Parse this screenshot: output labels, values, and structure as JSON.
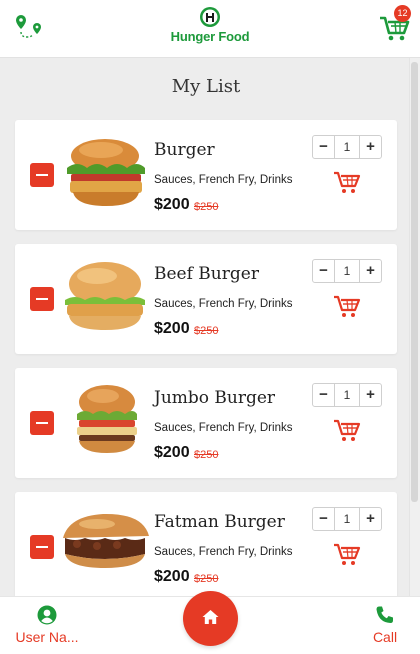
{
  "header": {
    "route_icon": "location-route-icon",
    "logo_icon": "chef-hat-icon",
    "logo_text": "Hunger Food",
    "cart_icon": "shopping-cart-icon",
    "cart_count": "12"
  },
  "page_title": "My List",
  "items": [
    {
      "name": "Burger",
      "description": "Sauces, French Fry, Drinks",
      "price": "$200",
      "old_price": "$250",
      "quantity": "1",
      "image": "burger"
    },
    {
      "name": "Beef Burger",
      "description": "Sauces, French Fry, Drinks",
      "price": "$200",
      "old_price": "$250",
      "quantity": "1",
      "image": "beef-burger"
    },
    {
      "name": "Jumbo Burger",
      "description": "Sauces, French Fry, Drinks",
      "price": "$200",
      "old_price": "$250",
      "quantity": "1",
      "image": "jumbo-burger"
    },
    {
      "name": "Fatman Burger",
      "description": "Sauces, French Fry, Drinks",
      "price": "$200",
      "old_price": "$250",
      "quantity": "1",
      "image": "fatman-burger"
    }
  ],
  "stepper": {
    "minus": "−",
    "plus": "+"
  },
  "bottom_nav": {
    "user_label": "User Na...",
    "user_icon": "user-circle-icon",
    "home_icon": "home-icon",
    "call_label": "Call",
    "call_icon": "phone-icon"
  },
  "colors": {
    "accent": "#e53a25",
    "brand_green": "#1d9a3b",
    "background": "#ededed"
  }
}
